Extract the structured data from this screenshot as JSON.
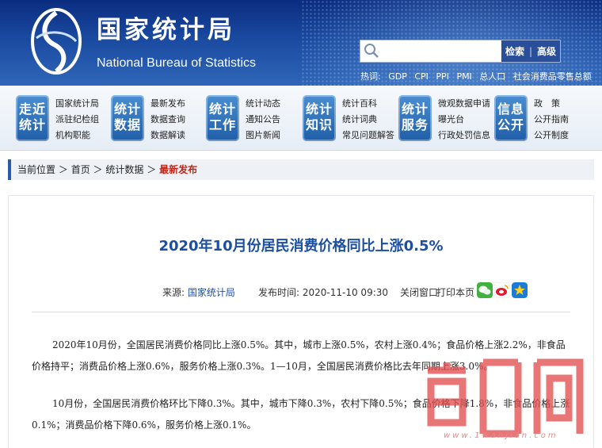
{
  "header": {
    "site_name_cn": "国家统计局",
    "site_name_en": "National Bureau of Statistics",
    "search": {
      "placeholder": "",
      "search_label": "检索",
      "advanced_label": "高级"
    },
    "hot_label": "热词:",
    "hot_terms": [
      "GDP",
      "CPI",
      "PPI",
      "PMI",
      "总人口",
      "社会消费品零售总额"
    ]
  },
  "nav": [
    {
      "tile": [
        "走近",
        "统计"
      ],
      "links": [
        "国家统计局",
        "派驻纪检组",
        "机构职能"
      ]
    },
    {
      "tile": [
        "统计",
        "数据"
      ],
      "links": [
        "最新发布",
        "数据查询",
        "数据解读"
      ]
    },
    {
      "tile": [
        "统计",
        "工作"
      ],
      "links": [
        "统计动态",
        "通知公告",
        "图片新闻"
      ]
    },
    {
      "tile": [
        "统计",
        "知识"
      ],
      "links": [
        "统计百科",
        "统计词典",
        "常见问题解答"
      ]
    },
    {
      "tile": [
        "统计",
        "服务"
      ],
      "links": [
        "微观数据申请",
        "曝光台",
        "行政处罚信息"
      ]
    },
    {
      "tile": [
        "信息",
        "公开"
      ],
      "links": [
        "政　策",
        "公开指南",
        "公开制度"
      ]
    }
  ],
  "breadcrumb": {
    "label": "当前位置",
    "sep": "＞",
    "items": [
      "首页",
      "统计数据"
    ],
    "current": "最新发布"
  },
  "article": {
    "title": "2020年10月份居民消费价格同比上涨0.5%",
    "source_label": "来源:",
    "source_value": "国家统计局",
    "time_label": "发布时间:",
    "time_value": "2020-11-10 09:30",
    "close_label": "关闭窗口",
    "print_label": "打印本页",
    "paragraphs": [
      "2020年10月份，全国居民消费价格同比上涨0.5%。其中，城市上涨0.5%，农村上涨0.4%；食品价格上涨2.2%，非食品价格持平；消费品价格上涨0.6%，服务价格上涨0.3%。1—10月，全国居民消费价格比去年同期上涨3.0%。",
      "10月份，全国居民消费价格环比下降0.3%。其中，城市下降0.3%，农村下降0.5%；食品价格下降1.8%，非食品价格上涨0.1%；消费品价格下降0.6%，服务价格上涨0.1%。"
    ]
  },
  "watermark": {
    "domain": "www.1wanjian.com"
  },
  "colors": {
    "header_blue": "#1a4aa0",
    "title_blue": "#1d4fa0",
    "current_red": "#c0271b",
    "tile_blue": "#1f5ea8"
  }
}
